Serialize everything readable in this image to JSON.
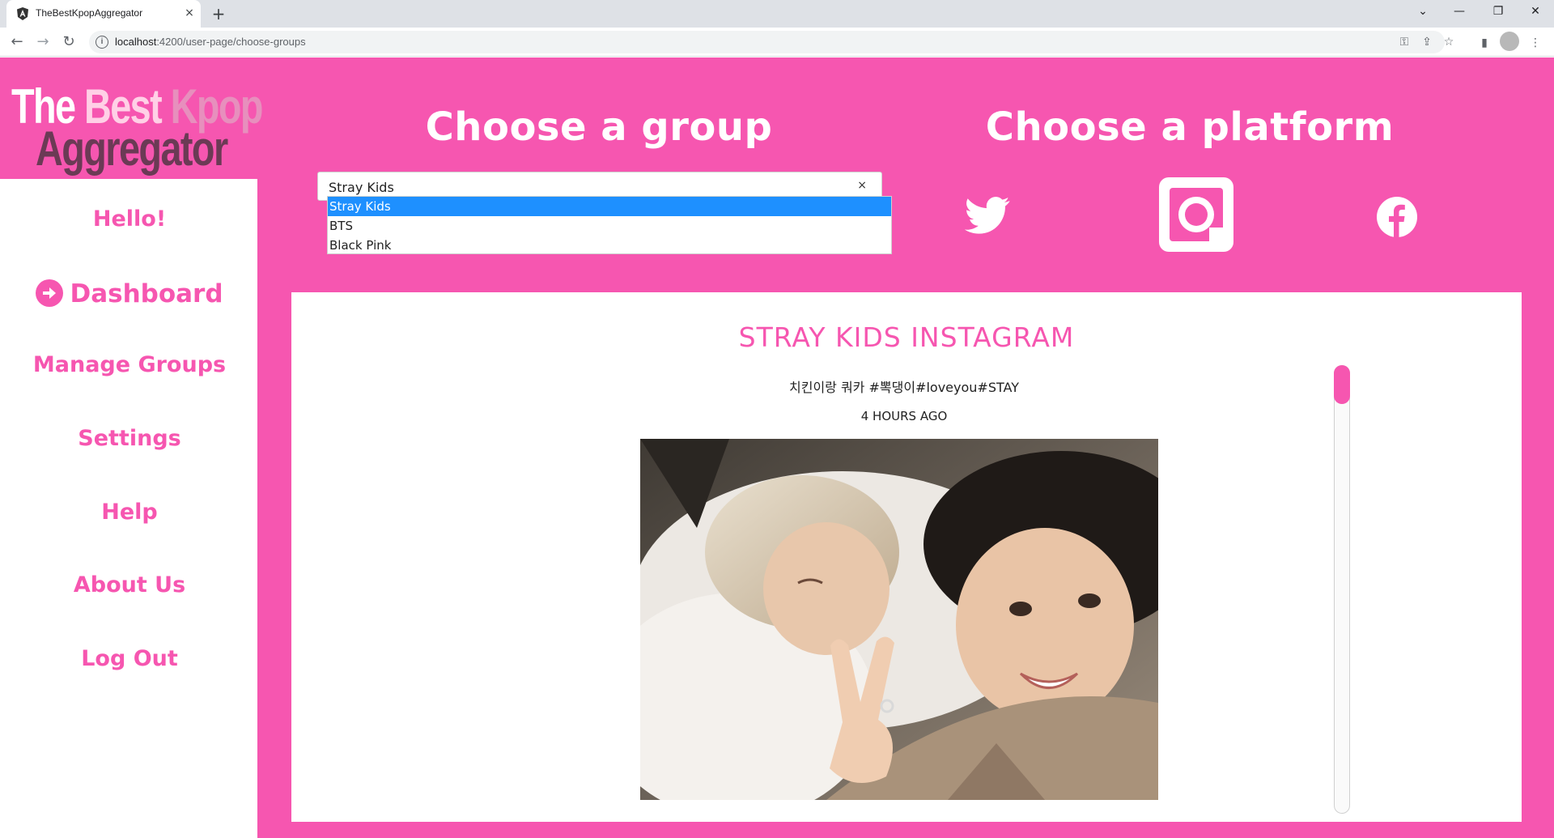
{
  "browser": {
    "tab_title": "TheBestKpopAggregator",
    "tab_close": "×",
    "new_tab": "+",
    "url_host": "localhost",
    "url_path": ":4200/user-page/choose-groups"
  },
  "logo": {
    "line1_a": "The ",
    "line1_b": "Best ",
    "line1_c": "Kpop",
    "line2": "Aggregator"
  },
  "sidebar": {
    "greeting": "Hello!",
    "items": [
      {
        "label": "Dashboard",
        "active": true
      },
      {
        "label": "Manage Groups"
      },
      {
        "label": "Settings"
      },
      {
        "label": "Help"
      },
      {
        "label": "About Us"
      },
      {
        "label": "Log Out"
      }
    ]
  },
  "group_section": {
    "heading": "Choose a group",
    "selected": "Stray Kids",
    "clear": "×",
    "options": [
      "Stray Kids",
      "BTS",
      "Black Pink"
    ]
  },
  "platform_section": {
    "heading": "Choose a platform",
    "platforms": [
      "twitter-icon",
      "instagram-icon",
      "facebook-icon"
    ]
  },
  "feed": {
    "title": "STRAY KIDS INSTAGRAM",
    "caption": "치킨이랑 쿼카 #뽁댕이#loveyou#STAY",
    "time": "4 HOURS AGO"
  },
  "colors": {
    "brand_pink": "#f656b0",
    "highlight_blue": "#1e90ff"
  }
}
